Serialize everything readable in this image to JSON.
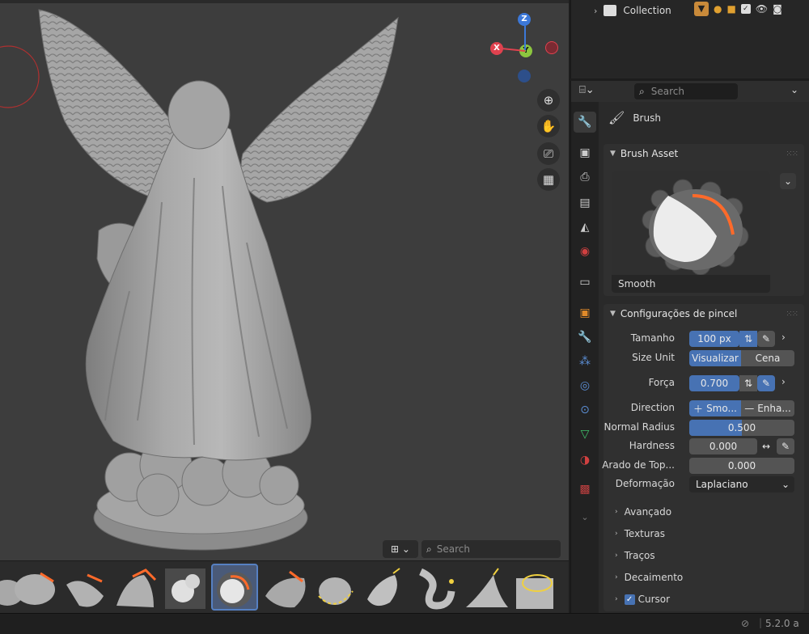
{
  "outliner": {
    "collection_label": "Collection"
  },
  "properties": {
    "search_placeholder": "Search",
    "section_title": "Brush",
    "brush_asset": {
      "panel_title": "Brush Asset",
      "brush_name": "Smooth"
    },
    "settings": {
      "panel_title": "Configurações de pincel",
      "tamanho": {
        "label": "Tamanho",
        "value": "100 px"
      },
      "size_unit": {
        "label": "Size Unit",
        "opt1": "Visualizar",
        "opt2": "Cena"
      },
      "forca": {
        "label": "Força",
        "value": "0.700",
        "fill": 0.7
      },
      "direction": {
        "label": "Direction",
        "opt1": "Smo...",
        "opt2": "Enha..."
      },
      "normal_radius": {
        "label": "Normal Radius",
        "value": "0.500",
        "fill": 0.5
      },
      "hardness": {
        "label": "Hardness",
        "value": "0.000"
      },
      "arado": {
        "label": "Arado de Top...",
        "value": "0.000"
      },
      "deformacao": {
        "label": "Deformação",
        "value": "Laplaciano"
      },
      "subpanels": [
        "Avançado",
        "Texturas",
        "Traços",
        "Decaimento",
        "Cursor"
      ]
    }
  },
  "shelf": {
    "search_placeholder": "Search"
  },
  "gizmo": {
    "z": "Z",
    "x": "X",
    "y": "Y"
  },
  "status": {
    "version": "5.2.0 a"
  }
}
